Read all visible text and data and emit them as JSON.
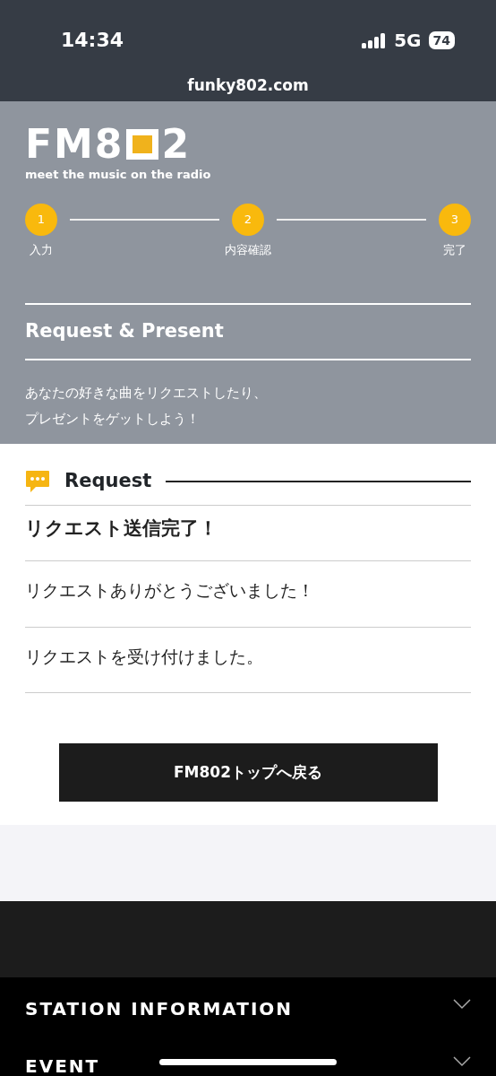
{
  "status_bar": {
    "time": "14:34",
    "network": "5G",
    "battery": "74",
    "url": "funky802.com"
  },
  "logo": {
    "parts": [
      "FM8",
      "2"
    ],
    "tagline": "meet the music on the radio"
  },
  "steps": [
    {
      "number": "1",
      "label": "入力"
    },
    {
      "number": "2",
      "label": "内容確認"
    },
    {
      "number": "3",
      "label": "完了"
    }
  ],
  "page_title": "Request & Present",
  "intro": [
    "あなたの好きな曲をリクエストしたり、",
    "プレゼントをゲットしよう！"
  ],
  "section": {
    "title": "Request",
    "heading": "リクエスト送信完了！",
    "messages": [
      "リクエストありがとうございました！",
      "リクエストを受け付けました。"
    ]
  },
  "button": "FM802トップへ戻る",
  "footer_menu": [
    {
      "label": "STATION INFORMATION",
      "expanded": false
    },
    {
      "label": "EVENT",
      "expanded": false
    }
  ]
}
